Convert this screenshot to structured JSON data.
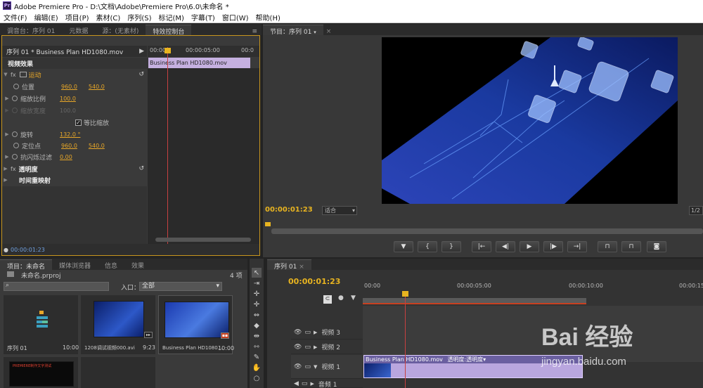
{
  "window": {
    "app_icon": "Pr",
    "title": "Adobe Premiere Pro - D:\\文档\\Adobe\\Premiere Pro\\6.0\\未命名 *"
  },
  "menu": [
    "文件(F)",
    "编辑(E)",
    "项目(P)",
    "素材(C)",
    "序列(S)",
    "标记(M)",
    "字幕(T)",
    "窗口(W)",
    "帮助(H)"
  ],
  "top_tabs": [
    "调音台：序列 01",
    "元数据",
    "源：(无素材)",
    "特效控制台"
  ],
  "ec": {
    "header": "序列 01 * Business Plan HD1080.mov",
    "ruler": [
      "00:00",
      "00:00:05:00",
      "00:0"
    ],
    "clip": "Business Plan HD1080.mov",
    "video_effects": "视频效果",
    "motion": "运动",
    "position": "位置",
    "position_x": "960.0",
    "position_y": "540.0",
    "scale": "缩放比例",
    "scale_val": "100.0",
    "scale_w": "缩放宽度",
    "scale_w_val": "100.0",
    "uniform": "等比缩放",
    "rotation": "旋转",
    "rotation_val": "132.0 °",
    "anchor": "定位点",
    "anchor_x": "960.0",
    "anchor_y": "540.0",
    "antiflicker": "抗闪烁过滤",
    "antiflicker_val": "0.00",
    "opacity": "透明度",
    "time_remap": "时间重映射",
    "timecode": "00:00:01:23"
  },
  "program": {
    "tab": "节目：序列 01",
    "timecode": "00:00:01:23",
    "fit": "适合",
    "page": "1/2"
  },
  "project": {
    "tabs": [
      "项目：未命名",
      "媒体浏览器",
      "信息",
      "效果"
    ],
    "filename": "未命名.prproj",
    "count": "4 项",
    "search_placeholder": "",
    "entry_label": "入口：",
    "entry_value": "全部",
    "items": [
      {
        "name": "序列 01",
        "dur": "10:00"
      },
      {
        "name": "1208调试视频000.avi",
        "dur": "9:23"
      },
      {
        "name": "Business Plan HD1080...",
        "dur": "10:00"
      }
    ],
    "thumb4_text": "PREMIERE制作文字测试"
  },
  "timeline": {
    "tab": "序列 01",
    "timecode": "00:00:01:23",
    "ruler": [
      "00:00",
      "00:00:05:00",
      "00:00:10:00",
      "00:00:15"
    ],
    "tracks": [
      "视频 3",
      "视频 2",
      "视频 1",
      "音频 1"
    ],
    "clip_name": "Business Plan HD1080.mov",
    "clip_fx": "透明度:透明度",
    "clip_fx_arrow": "▾"
  },
  "watermark": {
    "logo": "Bai 经验",
    "url": "jingyan.baidu.com"
  }
}
